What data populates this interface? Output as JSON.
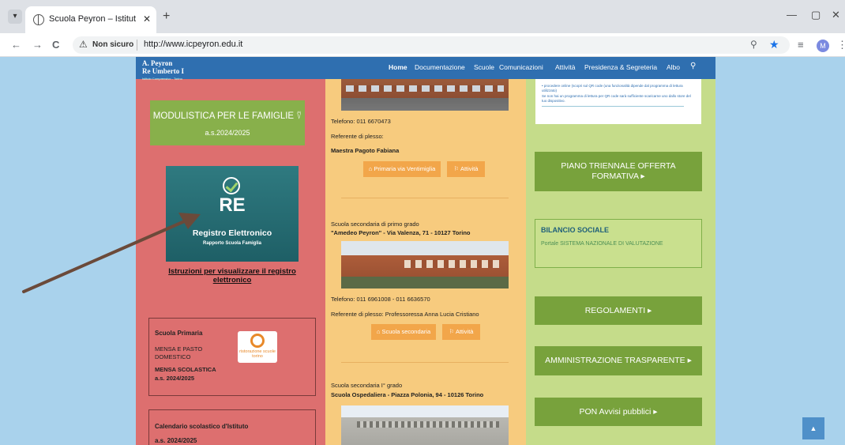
{
  "browser": {
    "tab_title": "Scuola Peyron – Istituto Compr",
    "tab_menu_icon": "▾",
    "tab_close_icon": "✕",
    "new_tab_icon": "+",
    "win_minimize_icon": "—",
    "win_restore_icon": "▢",
    "win_close_icon": "✕",
    "back_icon": "←",
    "forward_icon": "→",
    "reload_icon": "C",
    "warning_icon": "⚠",
    "security_label": "Non sicuro",
    "url": "http://www.icpeyron.edu.it",
    "zoom_icon": "⚲",
    "star_icon": "★",
    "reading_list_icon": "≡",
    "profile_initial": "M",
    "menu_icon": "⋮"
  },
  "site_nav": {
    "logo_line1": "A. Peyron",
    "logo_line2": "Re Umberto I",
    "logo_sub": "Istituto Comprensivo - Torino",
    "items": [
      "Home",
      "Documentazione",
      "Scuole",
      "Comunicazioni",
      "Attività",
      "Presidenza & Segreteria",
      "Albo"
    ],
    "search_icon": "⚲"
  },
  "left": {
    "modulistica_title": "MODULISTICA PER LE FAMIGLIE ⍢",
    "modulistica_year": "a.s.2024/2025",
    "re_letters": "RE",
    "re_title": "Registro Elettronico",
    "re_sub": "Rapporto Scuola Famiglia",
    "instructions_link": "Istruzioni per visualizzare il registro elettronico",
    "primaria_title": "Scuola Primaria",
    "mensa_pasto": "MENSA E PASTO DOMESTICO",
    "mensa_scolastica": "MENSA SCOLASTICA",
    "mensa_year": "a.s. 2024/2025",
    "ristorazione_logo_text": "ristorazione scuole torino",
    "calendario_title": "Calendario scolastico d'Istituto",
    "calendario_year": "a.s. 2024/2025"
  },
  "middle": {
    "phone1": "Telefono: 011 6670473",
    "ref1_label": "Referente di plesso:",
    "ref1_name": "Maestra Pagoto Fabiana",
    "btn_primaria": "⌂ Primaria via Ventimiglia",
    "btn_attivita1": "⚐ Attività",
    "sec1_type": "Scuola secondaria di primo grado",
    "sec1_name": "\"Amedeo Peyron\" - Via Valenza, 71 - 10127 Torino",
    "phone2": "Telefono: 011 6961008 - 011 6636570",
    "ref2": "Referente di plesso: Professoressa Anna Lucia Cristiano",
    "btn_secondaria": "⌂ Scuola secondaria",
    "btn_attivita2": "⚐ Attività",
    "sec2_type": "Scuola secondaria I° grado",
    "sec2_name": "Scuola Ospedaliera - Piazza Polonia, 94 - 10126 Torino"
  },
  "right": {
    "qr_text1": "• procedere online (scopri sul QR code (una funzionalità dipende dal programma di lettura utilizzato)",
    "qr_text2": "Se non hai un programma di lettura per QR code sarà sufficiente scaricarne uno dallo store del tuo dispositivo.",
    "ptof_label": "PIANO TRIENNALE OFFERTA FORMATIVA ▸",
    "bilancio_title": "BILANCIO SOCIALE",
    "bilancio_text": "Portale SISTEMA NAZIONALE DI VALUTAZIONE",
    "regolamenti_label": "REGOLAMENTI ▸",
    "amministrazione_label": "AMMINISTRAZIONE TRASPARENTE ▸",
    "pon_label": "PON Avvisi pubblici ▸"
  },
  "scroll_top_icon": "▲"
}
